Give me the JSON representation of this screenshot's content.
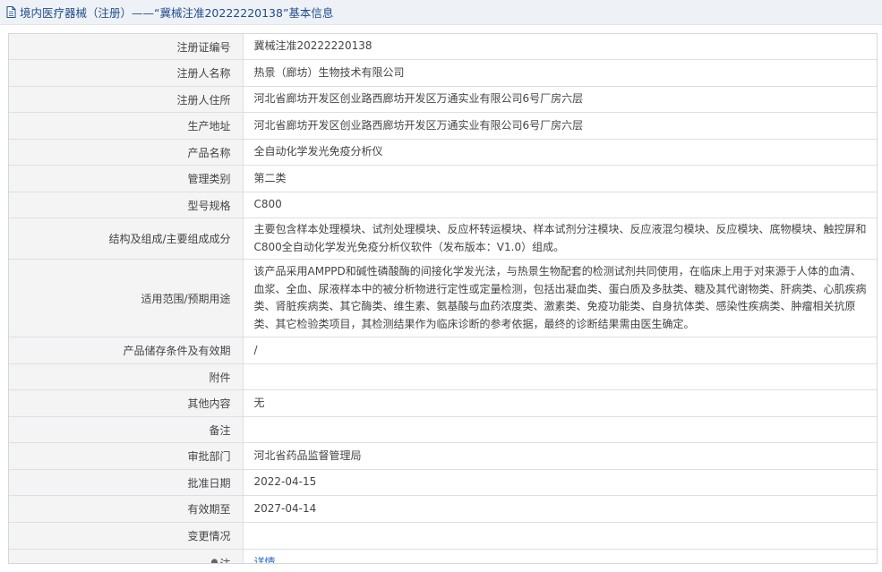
{
  "title": "境内医疗器械（注册）——“冀械注准20222220138”基本信息",
  "icons": {
    "title_icon": "document-icon",
    "note_icon": "lightbulb-icon"
  },
  "rows": [
    {
      "label": "注册证编号",
      "value": "冀械注准20222220138"
    },
    {
      "label": "注册人名称",
      "value": "热景（廊坊）生物技术有限公司"
    },
    {
      "label": "注册人住所",
      "value": "河北省廊坊开发区创业路西廊坊开发区万通实业有限公司6号厂房六层"
    },
    {
      "label": "生产地址",
      "value": "河北省廊坊开发区创业路西廊坊开发区万通实业有限公司6号厂房六层"
    },
    {
      "label": "产品名称",
      "value": "全自动化学发光免疫分析仪"
    },
    {
      "label": "管理类别",
      "value": "第二类"
    },
    {
      "label": "型号规格",
      "value": "C800"
    },
    {
      "label": "结构及组成/主要组成成分",
      "value": "主要包含样本处理模块、试剂处理模块、反应杯转运模块、样本试剂分注模块、反应液混匀模块、反应模块、底物模块、触控屏和C800全自动化学发光免疫分析仪软件（发布版本：V1.0）组成。"
    },
    {
      "label": "适用范围/预期用途",
      "value": "该产品采用AMPPD和碱性磷酸酶的间接化学发光法，与热景生物配套的检测试剂共同使用，在临床上用于对来源于人体的血清、血浆、全血、尿液样本中的被分析物进行定性或定量检测，包括出凝血类、蛋白质及多肽类、糖及其代谢物类、肝病类、心肌疾病类、肾脏疾病类、其它酶类、维生素、氨基酸与血药浓度类、激素类、免疫功能类、自身抗体类、感染性疾病类、肿瘤相关抗原类、其它检验类项目，其检测结果作为临床诊断的参考依据，最终的诊断结果需由医生确定。"
    },
    {
      "label": "产品储存条件及有效期",
      "value": "/"
    },
    {
      "label": "附件",
      "value": ""
    },
    {
      "label": "其他内容",
      "value": "无"
    },
    {
      "label": "备注",
      "value": ""
    },
    {
      "label": "审批部门",
      "value": "河北省药品监督管理局"
    },
    {
      "label": "批准日期",
      "value": "2022-04-15"
    },
    {
      "label": "有效期至",
      "value": "2027-04-14"
    },
    {
      "label": "变更情况",
      "value": ""
    }
  ],
  "note": {
    "label": "注",
    "link": "详情"
  }
}
